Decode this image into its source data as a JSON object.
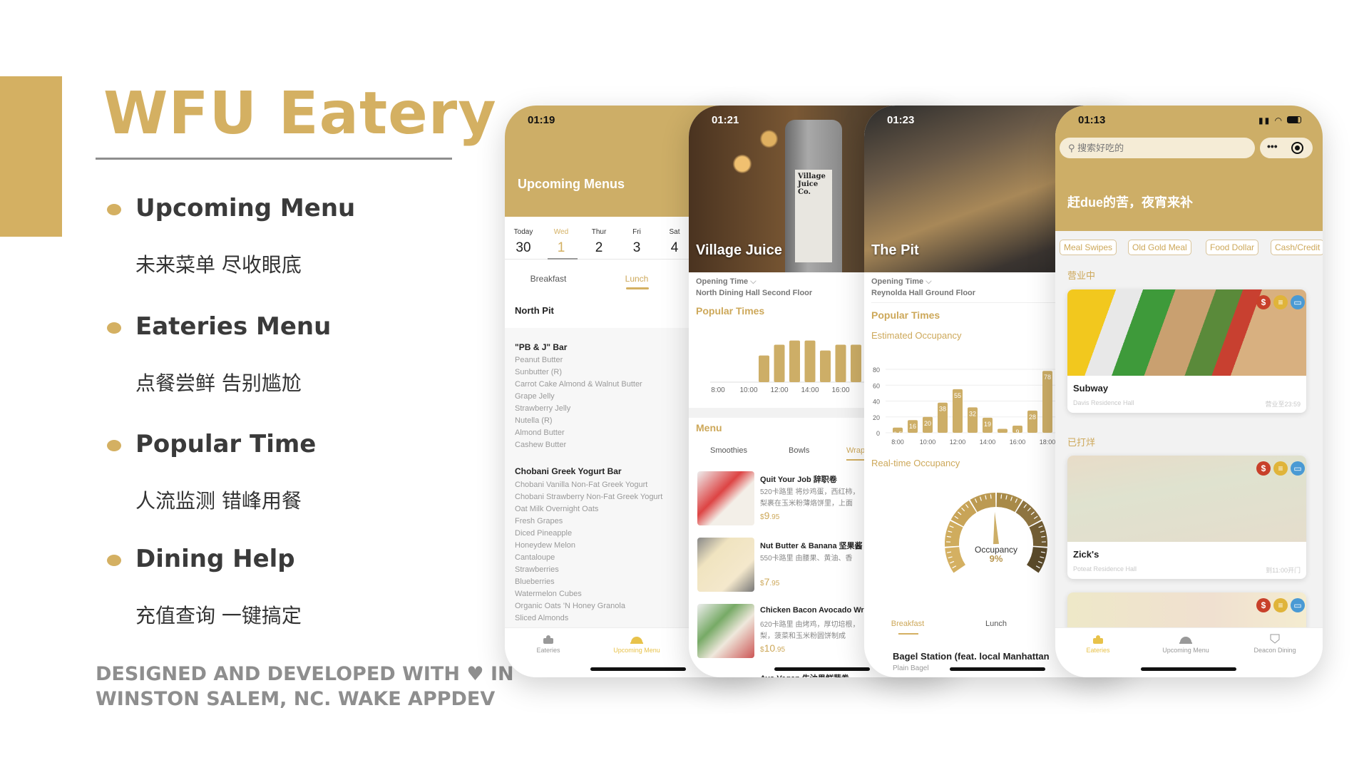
{
  "brand": {
    "title": "WFU Eatery",
    "accent": "#d4b062"
  },
  "features": [
    {
      "en": "Upcoming Menu",
      "zh": "未来菜单 尽收眼底"
    },
    {
      "en": "Eateries Menu",
      "zh": "点餐尝鲜 告别尴尬"
    },
    {
      "en": "Popular Time",
      "zh": "人流监测 错峰用餐"
    },
    {
      "en": "Dining Help",
      "zh": "充值查询 一键搞定"
    }
  ],
  "footer": {
    "line1": "DESIGNED AND DEVELOPED WITH ♥ IN",
    "line2": "WINSTON SALEM, NC. WAKE APPDEV"
  },
  "phone1": {
    "time": "01:19",
    "title": "Upcoming Menus",
    "days": [
      {
        "label": "Today",
        "num": "30"
      },
      {
        "label": "Wed",
        "num": "1",
        "selected": true
      },
      {
        "label": "Thur",
        "num": "2"
      },
      {
        "label": "Fri",
        "num": "3"
      },
      {
        "label": "Sat",
        "num": "4"
      }
    ],
    "meals": [
      "Breakfast",
      "Lunch"
    ],
    "active_meal": "Lunch",
    "location": "North Pit",
    "stations": [
      {
        "name": "\"PB & J\" Bar",
        "items": [
          "Peanut Butter",
          "Sunbutter (R)",
          "Carrot Cake Almond & Walnut Butter",
          "Grape Jelly",
          "Strawberry Jelly",
          "Nutella (R)",
          "Almond Butter",
          "Cashew Butter"
        ]
      },
      {
        "name": "Chobani Greek Yogurt Bar",
        "items": [
          "Chobani Vanilla Non-Fat Greek Yogurt",
          "Chobani Strawberry Non-Fat Greek Yogurt",
          "Oat Milk Overnight Oats",
          "Fresh Grapes",
          "Diced Pineapple",
          "Honeydew Melon",
          "Cantaloupe",
          "Strawberries",
          "Blueberries",
          "Watermelon Cubes",
          "Organic Oats 'N Honey Granola",
          "Sliced Almonds"
        ]
      }
    ],
    "tabs": [
      {
        "label": "Eateries",
        "icon": "eateries-icon"
      },
      {
        "label": "Upcoming Menu",
        "icon": "cloche-icon",
        "active": true
      }
    ]
  },
  "phone2": {
    "time": "01:21",
    "name": "Village Juice",
    "bottle_label": "Village Juice Co.",
    "opening_time": "Opening Time",
    "location": "North Dining Hall Second Floor",
    "popular_times": "Popular Times",
    "chart_data": {
      "type": "bar",
      "x_ticks": [
        "8:00",
        "10:00",
        "12:00",
        "14:00",
        "16:00"
      ],
      "values": [
        32,
        45,
        50,
        50,
        38,
        45,
        45
      ]
    },
    "menu_title": "Menu",
    "categories": [
      "Smoothies",
      "Bowls",
      "Wraps"
    ],
    "active_category": "Wraps",
    "items": [
      {
        "title": "Quit Your Job 辞职卷",
        "desc": [
          "520卡路里 将炒鸡蛋，西红柿，",
          "梨裹在玉米粉薄烙饼里，上面"
        ],
        "cur": "$",
        "int": "9",
        "dec": ".95"
      },
      {
        "title": "Nut Butter & Banana 坚果酱",
        "desc": [
          "550卡路里 由腰果、黄油、香"
        ],
        "cur": "$",
        "int": "7",
        "dec": ".95"
      },
      {
        "title": "Chicken Bacon Avocado Wr",
        "desc": [
          "620卡路里 由烤鸡，厚切培根，",
          "梨，菠菜和玉米粉圆饼制成"
        ],
        "cur": "$",
        "int": "10",
        "dec": ".95"
      },
      {
        "title": "Avo Vegan 牛油果鲜蔬卷"
      }
    ]
  },
  "phone3": {
    "time": "01:23",
    "name": "The Pit",
    "opening_time": "Opening Time",
    "location": "Reynolda Hall Ground Floor",
    "popular_times": "Popular Times",
    "estimated": "Estimated Occupancy",
    "chart_data": {
      "type": "bar",
      "x": [
        "8:00",
        "9:00",
        "10:00",
        "11:00",
        "12:00",
        "13:00",
        "14:00",
        "15:00",
        "16:00",
        "17:00",
        "18:00"
      ],
      "values": [
        6.5,
        16,
        20,
        38,
        55,
        32,
        19,
        5,
        9,
        28,
        78
      ],
      "x_ticks": [
        "8:00",
        "10:00",
        "12:00",
        "14:00",
        "16:00",
        "18:00"
      ],
      "y_ticks": [
        0,
        20,
        40,
        60,
        80
      ],
      "ylim": [
        0,
        80
      ],
      "grid": true
    },
    "realtime": "Real-time Occupancy",
    "gauge": {
      "label": "Occupancy",
      "value_text": "9%",
      "value": 9
    },
    "meals": [
      "Breakfast",
      "Lunch"
    ],
    "active_meal": "Breakfast",
    "station": "Bagel Station (feat. local Manhattan",
    "first_item": "Plain Bagel"
  },
  "phone4": {
    "time": "01:13",
    "search_placeholder": "搜索好吃的",
    "banner": "赶due的苦，夜宵来补",
    "chips": [
      "Meal Swipes",
      "Old Gold Meal",
      "Food Dollar",
      "Cash/Credit"
    ],
    "open_heading": "营业中",
    "closed_heading": "已打烊",
    "cards": [
      {
        "name": "Subway",
        "location": "Davis Residence Hall",
        "status": "营业至23:59"
      },
      {
        "name": "Zick's",
        "location": "Poteat Residence Hall",
        "status": "到11:00开门"
      }
    ],
    "pay_colors": {
      "dollar": "#c8402a",
      "coins": "#e0b43a",
      "card": "#4a9ad4"
    },
    "tabs": [
      {
        "label": "Eateries",
        "icon": "eateries-icon",
        "active": true
      },
      {
        "label": "Upcoming Menu",
        "icon": "cloche-icon"
      },
      {
        "label": "Deacon Dining",
        "icon": "shield-icon"
      }
    ]
  }
}
